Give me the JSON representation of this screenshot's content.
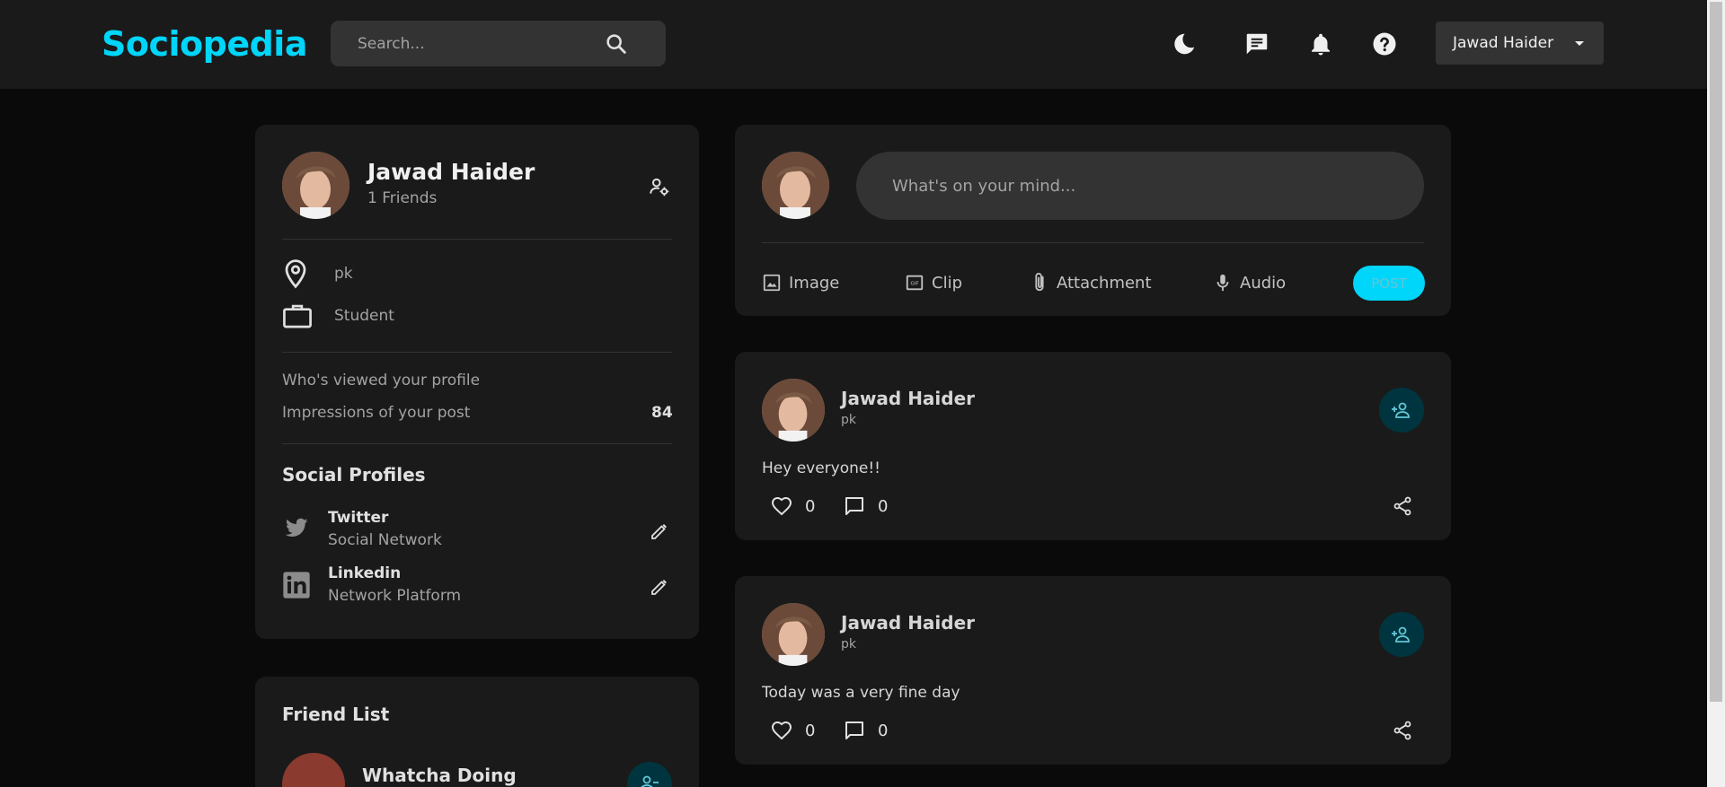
{
  "nav": {
    "brand": "Sociopedia",
    "search_placeholder": "Search...",
    "icons": [
      "search-icon",
      "dark-mode-icon",
      "message-icon",
      "notifications-icon",
      "help-icon"
    ],
    "user_select_value": "Jawad Haider"
  },
  "profile": {
    "name": "Jawad Haider",
    "friends": "1 Friends",
    "location": "pk",
    "occupation": "Student",
    "viewed_label": "Who's viewed your profile",
    "viewed_value": "",
    "impressions_label": "Impressions of your post",
    "impressions_value": "84",
    "social_title": "Social Profiles",
    "social": [
      {
        "name": "Twitter",
        "desc": "Social Network",
        "icon": "twitter-icon"
      },
      {
        "name": "Linkedin",
        "desc": "Network Platform",
        "icon": "linkedin-icon"
      }
    ]
  },
  "friends": {
    "title": "Friend List",
    "items": [
      {
        "name": "Whatcha Doing"
      }
    ]
  },
  "composer": {
    "placeholder": "What's on your mind...",
    "actions": [
      "Image",
      "Clip",
      "Attachment",
      "Audio"
    ],
    "post_label": "POST"
  },
  "posts": [
    {
      "author": "Jawad Haider",
      "location": "pk",
      "text": "Hey everyone!!",
      "likes": "0",
      "comments": "0"
    },
    {
      "author": "Jawad Haider",
      "location": "pk",
      "text": "Today was a very fine day",
      "likes": "0",
      "comments": "0"
    }
  ],
  "colors": {
    "accent": "#00d5fa",
    "background": "#0a0a0a",
    "card": "#1a1a1a",
    "input": "#333333"
  }
}
